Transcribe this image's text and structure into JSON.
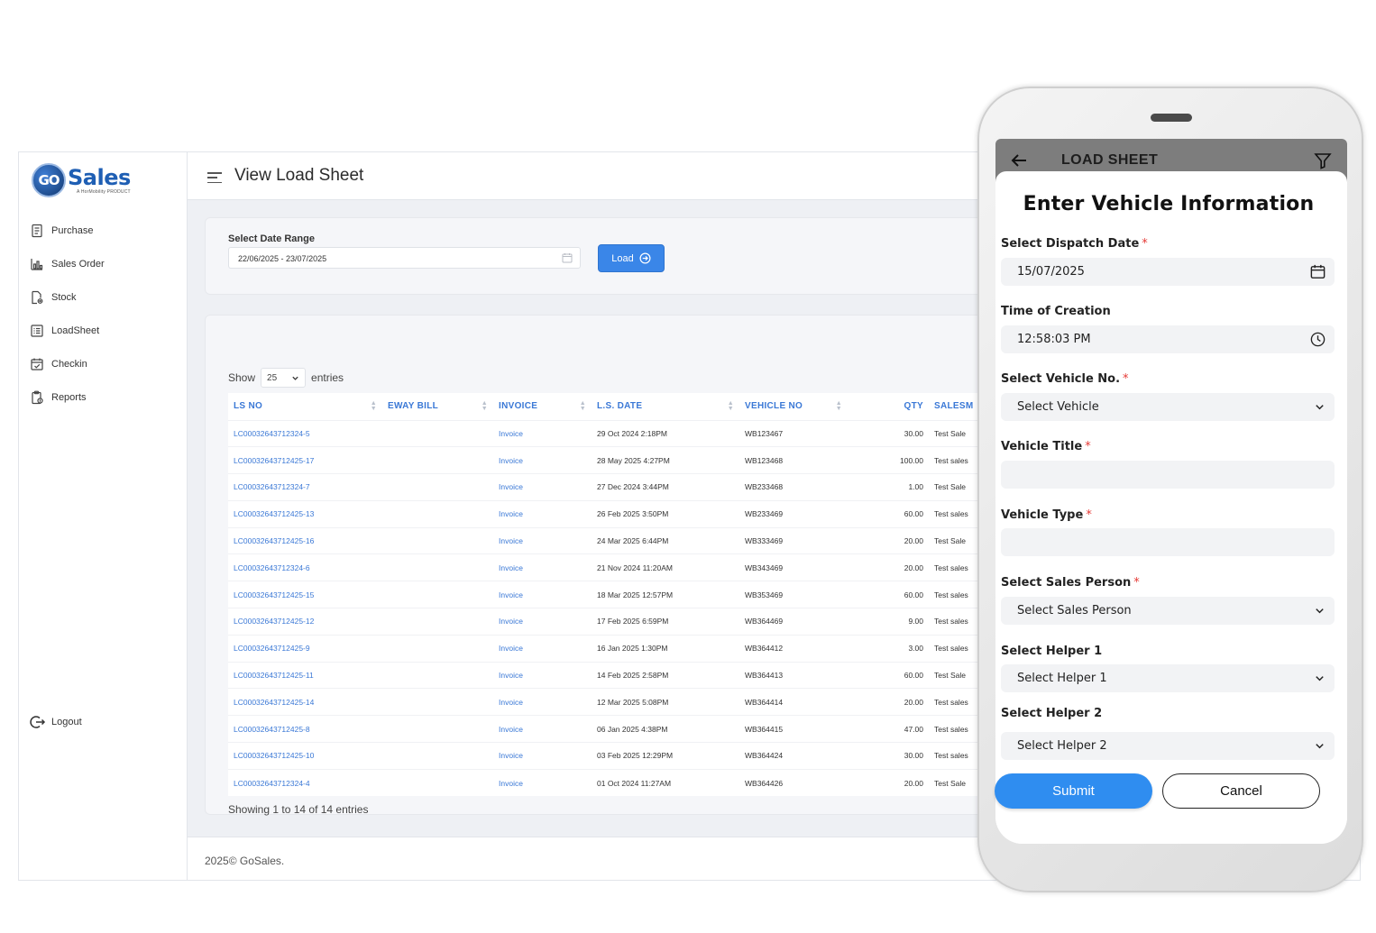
{
  "brand": {
    "name": "Sales",
    "badge": "GO",
    "tagline": "A HorMobility PRODUCT"
  },
  "sidebar": {
    "items": [
      {
        "label": "Purchase",
        "icon": "document-icon"
      },
      {
        "label": "Sales Order",
        "icon": "bar-chart-icon"
      },
      {
        "label": "Stock",
        "icon": "file-gear-icon"
      },
      {
        "label": "LoadSheet",
        "icon": "list-icon"
      },
      {
        "label": "Checkin",
        "icon": "calendar-check-icon"
      },
      {
        "label": "Reports",
        "icon": "report-icon"
      }
    ],
    "logout": "Logout"
  },
  "header": {
    "title": "View Load Sheet"
  },
  "filter": {
    "label": "Select Date Range",
    "value": "22/06/2025 - 23/07/2025",
    "load_label": "Load"
  },
  "table": {
    "show_label": "Show",
    "page_size": "25",
    "entries_label": "entries",
    "columns": [
      "LS NO",
      "EWAY BILL",
      "INVOICE",
      "L.S. DATE",
      "VEHICLE NO",
      "QTY",
      "SALESM"
    ],
    "rows": [
      [
        "LC00032643712324-5",
        "",
        "Invoice",
        "29 Oct 2024 2:18PM",
        "WB123467",
        "30.00",
        "Test Sale"
      ],
      [
        "LC00032643712425-17",
        "",
        "Invoice",
        "28 May 2025 4:27PM",
        "WB123468",
        "100.00",
        "Test sales"
      ],
      [
        "LC00032643712324-7",
        "",
        "Invoice",
        "27 Dec 2024 3:44PM",
        "WB233468",
        "1.00",
        "Test Sale"
      ],
      [
        "LC00032643712425-13",
        "",
        "Invoice",
        "26 Feb 2025 3:50PM",
        "WB233469",
        "60.00",
        "Test sales"
      ],
      [
        "LC00032643712425-16",
        "",
        "Invoice",
        "24 Mar 2025 6:44PM",
        "WB333469",
        "20.00",
        "Test Sale"
      ],
      [
        "LC00032643712324-6",
        "",
        "Invoice",
        "21 Nov 2024 11:20AM",
        "WB343469",
        "20.00",
        "Test sales"
      ],
      [
        "LC00032643712425-15",
        "",
        "Invoice",
        "18 Mar 2025 12:57PM",
        "WB353469",
        "60.00",
        "Test sales"
      ],
      [
        "LC00032643712425-12",
        "",
        "Invoice",
        "17 Feb 2025 6:59PM",
        "WB364469",
        "9.00",
        "Test sales"
      ],
      [
        "LC00032643712425-9",
        "",
        "Invoice",
        "16 Jan 2025 1:30PM",
        "WB364412",
        "3.00",
        "Test sales"
      ],
      [
        "LC00032643712425-11",
        "",
        "Invoice",
        "14 Feb 2025 2:58PM",
        "WB364413",
        "60.00",
        "Test Sale"
      ],
      [
        "LC00032643712425-14",
        "",
        "Invoice",
        "12 Mar 2025 5:08PM",
        "WB364414",
        "20.00",
        "Test sales"
      ],
      [
        "LC00032643712425-8",
        "",
        "Invoice",
        "06 Jan 2025 4:38PM",
        "WB364415",
        "47.00",
        "Test sales"
      ],
      [
        "LC00032643712425-10",
        "",
        "Invoice",
        "03 Feb 2025 12:29PM",
        "WB364424",
        "30.00",
        "Test sales"
      ],
      [
        "LC00032643712324-4",
        "",
        "Invoice",
        "01 Oct 2024 11:27AM",
        "WB364426",
        "20.00",
        "Test Sale"
      ]
    ],
    "summary": "Showing 1 to 14 of 14 entries"
  },
  "footer": {
    "text": "2025© GoSales."
  },
  "phone": {
    "app_title": "LOAD SHEET",
    "form_title": "Enter Vehicle Information",
    "fields": {
      "dispatch_date": {
        "label": "Select Dispatch Date",
        "value": "15/07/2025"
      },
      "time_of_creation": {
        "label": "Time of Creation",
        "value": "12:58:03 PM"
      },
      "vehicle_no": {
        "label": "Select Vehicle No.",
        "value": "Select Vehicle"
      },
      "vehicle_title": {
        "label": "Vehicle Title",
        "value": ""
      },
      "vehicle_type": {
        "label": "Vehicle Type",
        "value": ""
      },
      "sales_person": {
        "label": "Select Sales Person",
        "value": "Select Sales Person"
      },
      "helper1": {
        "label": "Select Helper 1",
        "value": "Select Helper 1"
      },
      "helper2": {
        "label": "Select Helper 2",
        "value": "Select Helper 2"
      }
    },
    "required_mark": "*",
    "submit_label": "Submit",
    "cancel_label": "Cancel"
  },
  "colors": {
    "accent": "#3a86e8",
    "link": "#3a78d6",
    "brand": "#1f5fb4",
    "required": "#e53935",
    "appbar": "#7d7d7d"
  }
}
